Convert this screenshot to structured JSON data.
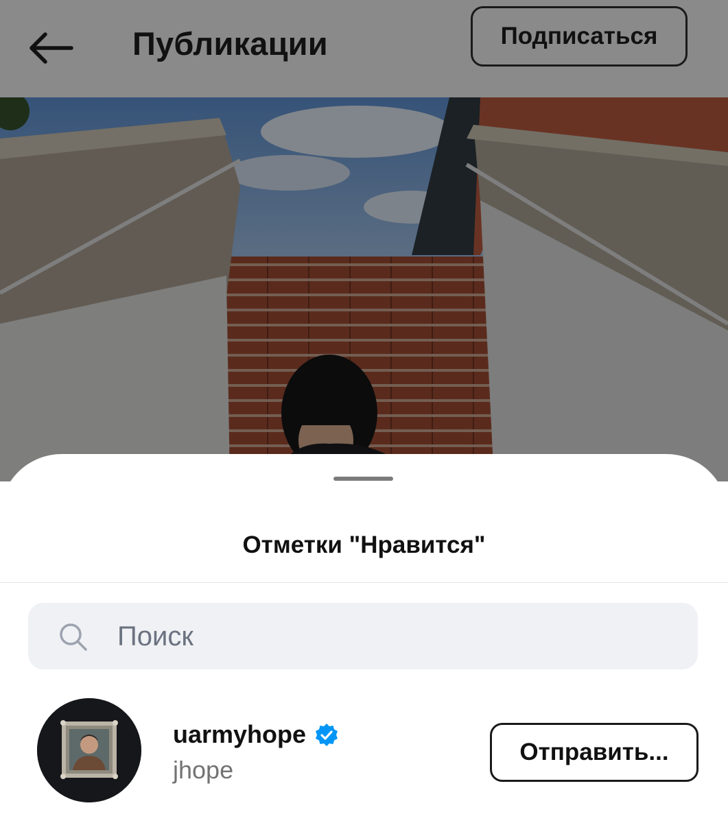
{
  "header": {
    "back_icon": "arrow-left-icon",
    "title": "Публикации",
    "follow_label": "Подписаться"
  },
  "post": {
    "image_description_icon": "post-photo"
  },
  "likes_sheet": {
    "title": "Отметки \"Нравится\"",
    "search": {
      "placeholder": "Поиск",
      "value": "",
      "icon": "search-icon"
    },
    "users": [
      {
        "username": "uarmyhope",
        "verified": true,
        "full_name": "jhope",
        "action_label": "Отправить..."
      }
    ]
  },
  "colors": {
    "verified_badge": "#0095f6",
    "search_bg": "#eff1f4",
    "overlay": "#8a8a8a"
  }
}
